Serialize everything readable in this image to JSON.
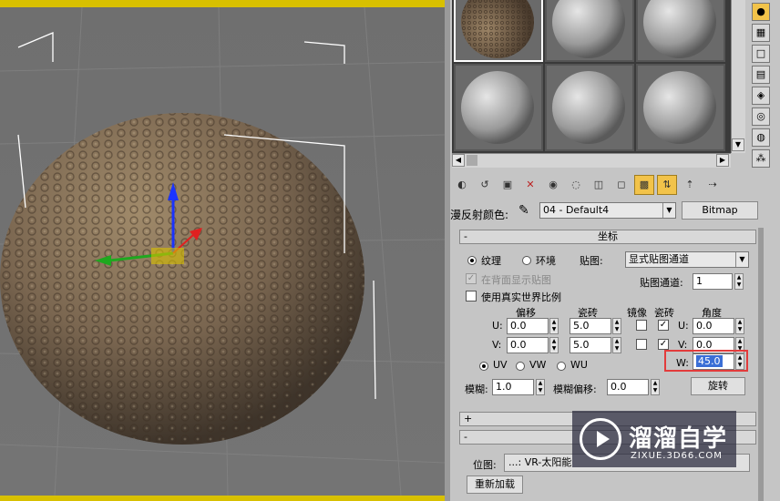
{
  "diffuse": {
    "label": "漫反射颜色:",
    "material_name": "04 - Default4",
    "map_type_button": "Bitmap"
  },
  "coords_rollout": {
    "title": "坐标",
    "collapse_symbol": "-",
    "mode_texture": "纹理",
    "mode_environment": "环境",
    "mapping_label": "贴图:",
    "mapping_value": "显式贴图通道",
    "show_back": "在背面显示贴图",
    "real_world": "使用真实世界比例",
    "channel_label": "贴图通道:",
    "channel_value": "1",
    "headers": {
      "offset": "偏移",
      "tiling": "瓷砖",
      "mirror": "镜像",
      "tile": "瓷砖",
      "angle": "角度"
    },
    "u_label": "U:",
    "v_label": "V:",
    "w_label": "W:",
    "u_offset": "0.0",
    "v_offset": "0.0",
    "u_tiling": "5.0",
    "v_tiling": "5.0",
    "u_angle": "0.0",
    "v_angle": "0.0",
    "w_angle": "45.0",
    "uv": "UV",
    "vw": "VW",
    "wu": "WU",
    "blur_label": "模糊:",
    "blur_value": "1.0",
    "blur_offset_label": "模糊偏移:",
    "blur_offset_value": "0.0",
    "rotate_button": "旋转"
  },
  "collapsed_rollout": {
    "symbol": "+"
  },
  "bitmap_rollout": {
    "symbol": "-",
    "position_label": "位图:",
    "path": "...: VR-太阳能",
    "reload_button": "重新加载"
  },
  "watermark": {
    "title": "溜溜自学",
    "subtitle": "ZIXUE.3D66.COM"
  },
  "colors": {
    "highlight": "#e23b3b",
    "active_tool": "#f2c34a",
    "viewport_border": "#d8c000"
  }
}
